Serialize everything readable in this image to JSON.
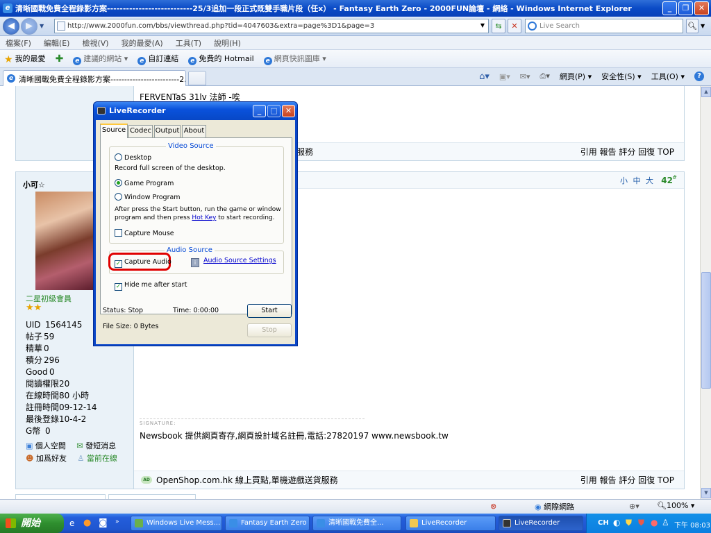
{
  "browser": {
    "title": "清晰國戰免費全程錄影方案---------------------------25/3追加一段正式既雙手職片段（任x） - Fantasy Earth Zero - 2000FUN論壇 - 網絡 - Windows Internet Explorer",
    "url": "http://www.2000fun.com/bbs/viewthread.php?tid=4047603&extra=page%3D1&page=3",
    "search_placeholder": "Live Search",
    "menu": [
      "檔案(F)",
      "編輯(E)",
      "檢視(V)",
      "我的最愛(A)",
      "工具(T)",
      "說明(H)"
    ],
    "favorites": {
      "my_favorites": "我的最愛",
      "suggested_sites": "建議的網站",
      "custom_links": "自訂連結",
      "hotmail": "免費的 Hotmail",
      "web_slice": "網頁快訊圖庫"
    },
    "tab_title": "清晰國戰免費全程錄影方案-------------------------2...",
    "command_bar": {
      "page": "網頁(P)",
      "safety": "安全性(S)",
      "tools": "工具(O)"
    },
    "status": {
      "zone": "網際網路",
      "zoom": "100%"
    }
  },
  "forum": {
    "top_post_text": "FERVENTaS 31lv 法師 -唉",
    "top_bottom_text": "貨服務",
    "post_actions": "引用 報告 評分 回復 TOP",
    "user": {
      "name": "小可☆",
      "rank": "二星初級會員",
      "stars": "★★",
      "stats": [
        {
          "k": "UID",
          "v": "1564145"
        },
        {
          "k": "帖子",
          "v": "59"
        },
        {
          "k": "精華",
          "v": "0"
        },
        {
          "k": "積分",
          "v": "296"
        },
        {
          "k": "Good",
          "v": "0"
        },
        {
          "k": "閱讀權限",
          "v": "20"
        },
        {
          "k": "在線時間",
          "v": "80 小時"
        },
        {
          "k": "註冊時間",
          "v": "09-12-14"
        },
        {
          "k": "最後登錄",
          "v": "10-4-2"
        },
        {
          "k": "G幣",
          "v": "0"
        }
      ],
      "links": {
        "space": "個人空間",
        "message": "發短消息",
        "add_friend": "加爲好友",
        "online": "當前在線"
      }
    },
    "font_size": "小 中 大",
    "post_number": "42",
    "post_number_suffix": "#",
    "signature_label": "SIGNATURE:",
    "signature_text": "Newsbook 提供網頁寄存,網頁設計域名註冊,電話:27820197 www.newsbook.tw",
    "ad_badge": "AD",
    "ad_text": "OpenShop.com.hk 線上買點,單機遊戲送貨服務"
  },
  "dialog": {
    "title": "LiveRecorder",
    "tabs": [
      "Source",
      "Codec",
      "Output",
      "About"
    ],
    "video_source_label": "Video Source",
    "desktop": "Desktop",
    "desktop_desc": "Record full screen of the desktop.",
    "game_program": "Game Program",
    "window_program": "Window Program",
    "window_desc_1": "After press the Start button, run the game or window",
    "window_desc_2": "program and then press",
    "hot_key": "Hot Key",
    "window_desc_3": "to start recording.",
    "capture_mouse": "Capture Mouse",
    "audio_source_label": "Audio Source",
    "capture_audio": "Capture Audio",
    "audio_settings": "Audio Source Settings",
    "hide_me": "Hide me after start",
    "status": "Status: Stop",
    "time": "Time: 0:00:00",
    "file_size": "File Size: 0 Bytes",
    "start": "Start",
    "stop": "Stop"
  },
  "taskbar": {
    "start": "開始",
    "tasks": [
      "Windows Live Mess...",
      "Fantasy Earth Zero -...",
      "清晰國戰免費全...",
      "LiveRecorder",
      "LiveRecorder"
    ],
    "tray_lang": "CH",
    "clock": "下午 08:03"
  },
  "colors": {
    "highlight_red": "#e00000",
    "link_blue": "#0000cc",
    "forum_green": "#2a8a2a"
  }
}
